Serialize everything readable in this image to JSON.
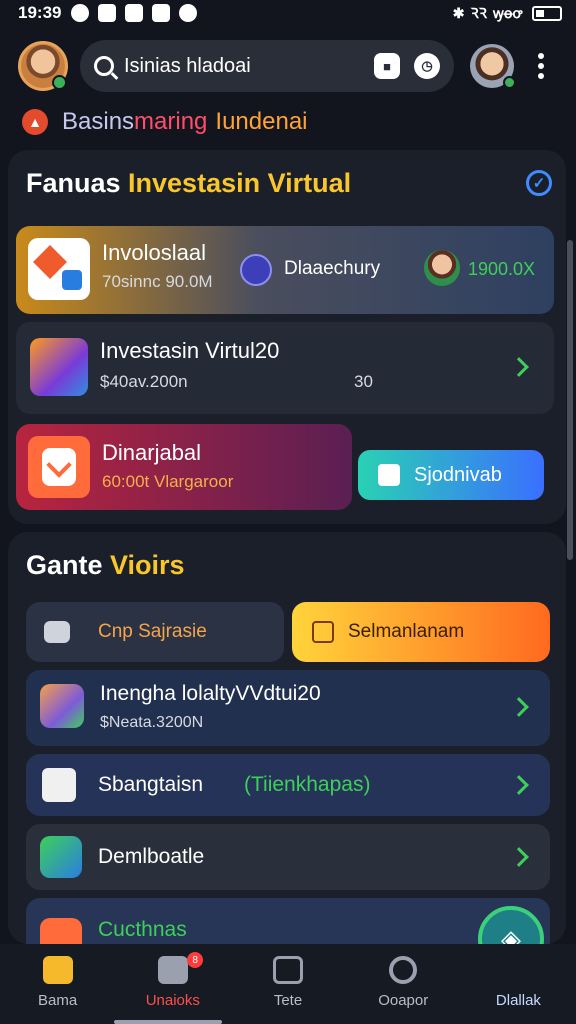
{
  "status_bar": {
    "time": "19:39",
    "signal_text": "ꝚꝚ",
    "wifi_text": "ꝡꝋꝍ"
  },
  "header": {
    "search_text": "Isinias hladoai"
  },
  "brand": {
    "part1": "Basins",
    "part2": "maring",
    "part3": "Iundenai"
  },
  "section1": {
    "title_white": "Fanuas ",
    "title_accent": "Investasin Virtual",
    "cards": [
      {
        "title": "Involoslaal",
        "subtitle": "70sinnc 90.0M",
        "middle": "Dlaaechury",
        "amount": "1900.0X"
      },
      {
        "title": "Investasin Virtul20",
        "subtitle": "$40av.200n",
        "right": "30"
      },
      {
        "title": "Dinarjabal",
        "subtitle": "60:00t Vlargaroor",
        "button": "Sjodnivab"
      }
    ]
  },
  "section2": {
    "title_white": "Gante ",
    "title_accent": "Vioirs",
    "chip_left": "Cnp Sajrasie",
    "chip_right": "Selmanlanam",
    "rows": [
      {
        "title": "Inengha lolaltyVVdtui20",
        "subtitle": "$Neata.3200N"
      },
      {
        "title": "Sbangtaisn",
        "tag": "(Tiienkhapas)"
      },
      {
        "title": "Demlboatle"
      },
      {
        "title": "Cucthnas"
      }
    ]
  },
  "tabbar": {
    "tabs": [
      {
        "label": "Bama"
      },
      {
        "label": "Unaioks"
      },
      {
        "label": "Tete"
      },
      {
        "label": "Ooapor"
      },
      {
        "label": "Dlallak"
      }
    ],
    "badge": "8"
  },
  "colors": {
    "accent_yellow": "#f9c62b",
    "accent_green": "#3ecf5a",
    "active_red": "#ff4d4d"
  }
}
